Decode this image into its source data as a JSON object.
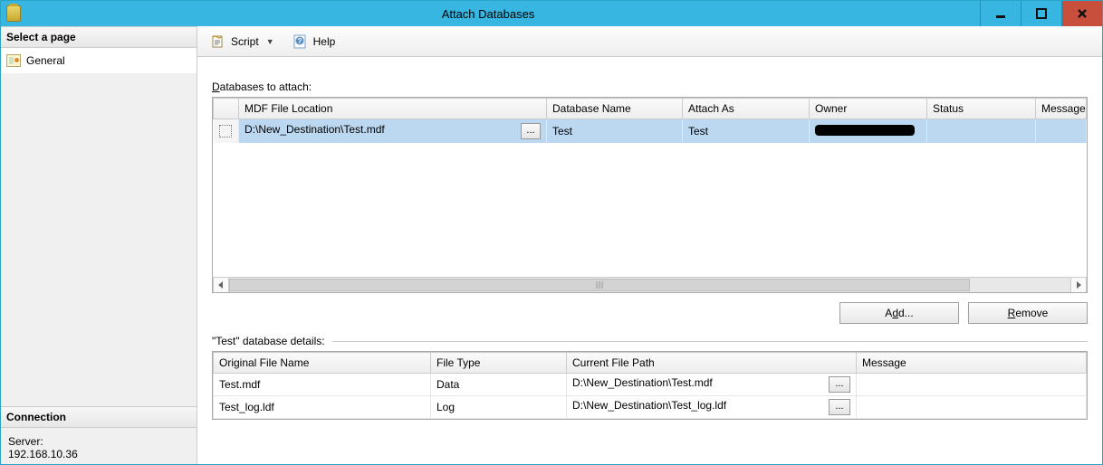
{
  "window": {
    "title": "Attach Databases"
  },
  "left": {
    "select_page": "Select a page",
    "pages": [
      {
        "label": "General"
      }
    ],
    "connection_header": "Connection",
    "server_label": "Server:",
    "server_value": "192.168.10.36"
  },
  "toolbar": {
    "script_label": "Script",
    "help_label": "Help"
  },
  "upper": {
    "label_before": "D",
    "label_after": "atabases to attach:",
    "columns": {
      "mdf": "MDF File Location",
      "dbname": "Database Name",
      "attachas": "Attach As",
      "owner": "Owner",
      "status": "Status",
      "message": "Message"
    },
    "rows": [
      {
        "mdf": "D:\\New_Destination\\Test.mdf",
        "dbname": "Test",
        "attachas": "Test",
        "owner": "[redacted]",
        "status": "",
        "message": ""
      }
    ],
    "add_btn_pfx": "A",
    "add_btn_u": "d",
    "add_btn_sfx": "d...",
    "remove_btn_u": "R",
    "remove_btn_sfx": "emove"
  },
  "details": {
    "header": "\"Test\" database details:",
    "columns": {
      "orig": "Original File Name",
      "ftype": "File Type",
      "path": "Current File Path",
      "message": "Message"
    },
    "rows": [
      {
        "orig": "Test.mdf",
        "ftype": "Data",
        "path": "D:\\New_Destination\\Test.mdf",
        "message": ""
      },
      {
        "orig": "Test_log.ldf",
        "ftype": "Log",
        "path": "D:\\New_Destination\\Test_log.ldf",
        "message": ""
      }
    ]
  }
}
